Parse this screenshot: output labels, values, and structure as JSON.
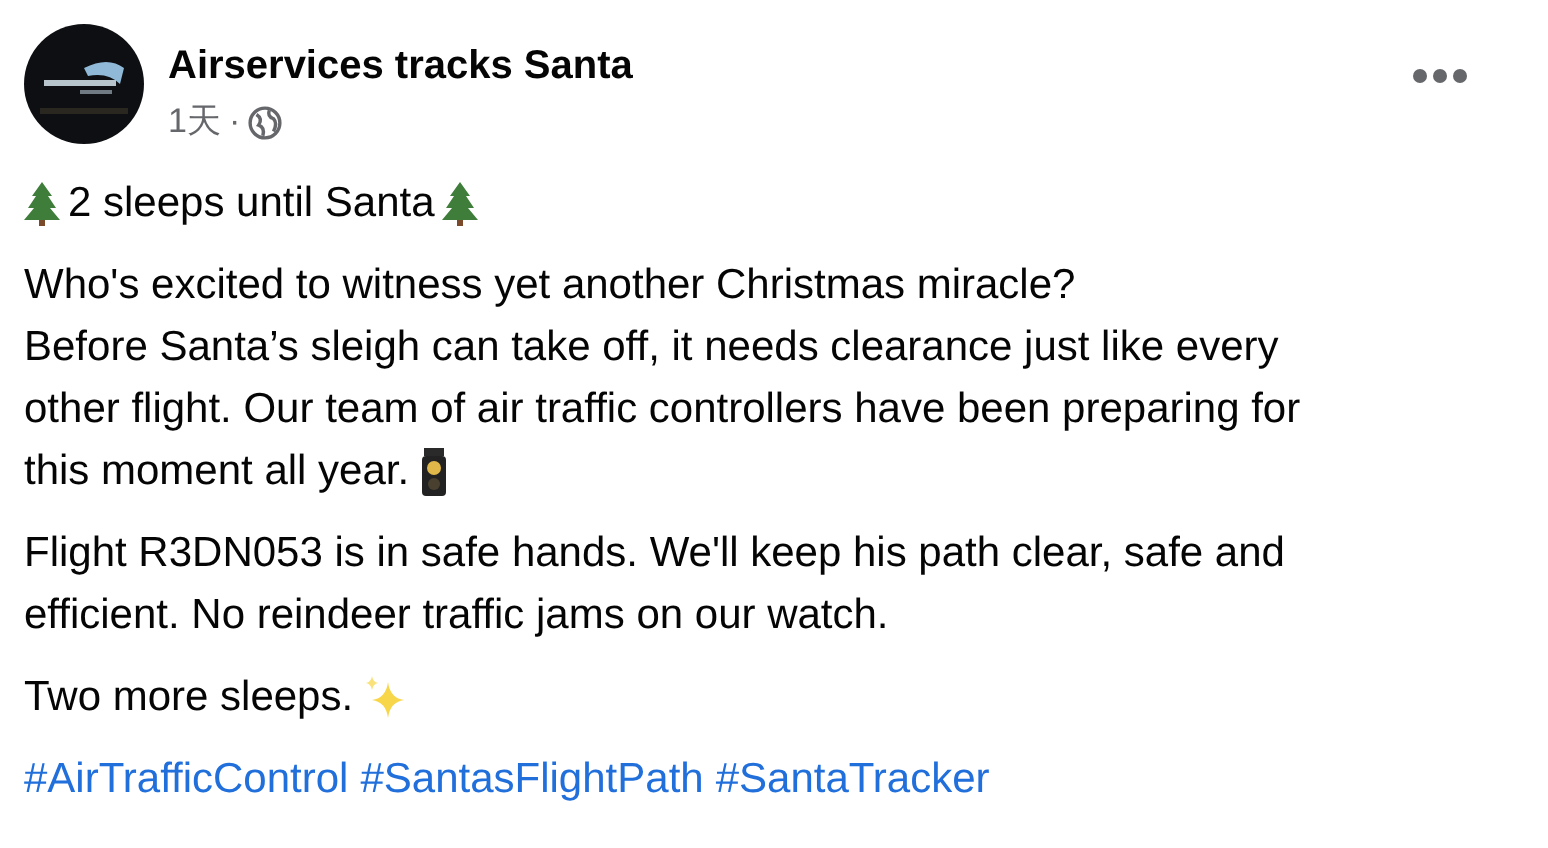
{
  "post": {
    "author": "Airservices tracks Santa",
    "time": "1天",
    "separator": "·",
    "paragraphs": [
      {
        "kind": "trees",
        "text": "2 sleeps until Santa"
      },
      {
        "kind": "lines",
        "lines": [
          "Who's excited to witness yet another Christmas miracle?",
          "Before Santa’s sleigh can take off, it needs clearance just like every",
          "other flight. Our team of air traffic controllers have been preparing for",
          "this moment all year."
        ],
        "end_icon": {
          "kind": "traffic-light"
        }
      },
      {
        "kind": "lines",
        "lines": [
          "Flight R3DN053 is in safe hands. We'll keep his path clear, safe and",
          "efficient. No reindeer traffic jams on our watch."
        ]
      },
      {
        "kind": "lines",
        "lines": [
          "Two more sleeps."
        ],
        "end_icon": {
          "kind": "sparkles"
        }
      },
      {
        "kind": "hashtags",
        "tags": [
          "#AirTrafficControl",
          "#SantasFlightPath",
          "#SantaTracker"
        ]
      }
    ]
  }
}
